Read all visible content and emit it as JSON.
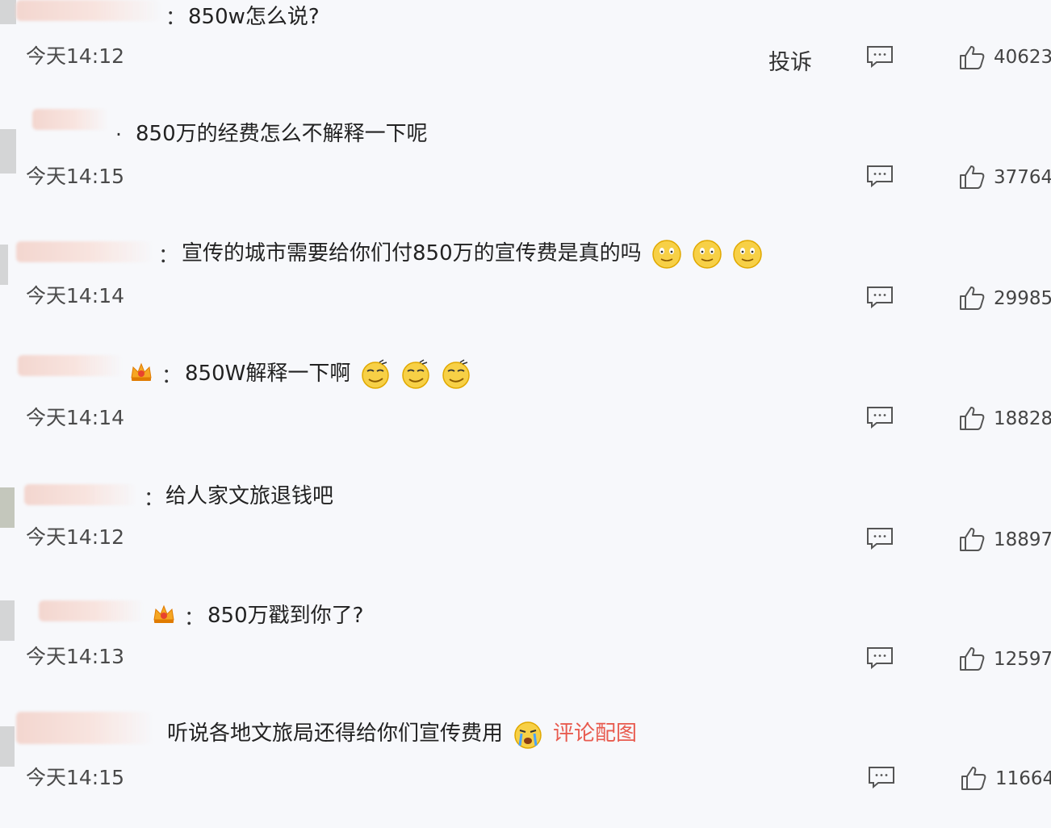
{
  "comments": [
    {
      "separator": "：",
      "text": "850w怎么说?",
      "time": "今天14:12",
      "likes": "40623",
      "report": "投诉",
      "badge": false,
      "emoji": [],
      "link": ""
    },
    {
      "separator": ".",
      "text": "850万的经费怎么不解释一下呢",
      "time": "今天14:15",
      "likes": "37764",
      "badge": false,
      "emoji": [],
      "link": ""
    },
    {
      "separator": "：",
      "text": "宣传的城市需要给你们付850万的宣传费是真的吗",
      "time": "今天14:14",
      "likes": "29985",
      "badge": false,
      "emoji": [
        "smile-emoji",
        "smile-emoji",
        "smile-emoji"
      ],
      "link": ""
    },
    {
      "separator": "：",
      "text": "850W解释一下啊",
      "time": "今天14:14",
      "likes": "18828",
      "badge": true,
      "emoji": [
        "smirk-emoji",
        "smirk-emoji",
        "smirk-emoji"
      ],
      "link": ""
    },
    {
      "separator": "：",
      "text": "给人家文旅退钱吧",
      "time": "今天14:12",
      "likes": "18897",
      "badge": false,
      "emoji": [],
      "link": ""
    },
    {
      "separator": "：",
      "text": "850万戳到你了?",
      "time": "今天14:13",
      "likes": "12597",
      "badge": true,
      "emoji": [],
      "link": ""
    },
    {
      "separator": "",
      "text": "听说各地文旅局还得给你们宣传费用",
      "time": "今天14:15",
      "likes": "11664",
      "badge": false,
      "emoji": [
        "crying-emoji"
      ],
      "link": "评论配图"
    }
  ],
  "colors": {
    "background": "#f7f8fb",
    "link": "#e85b4f",
    "icon": "#555555"
  }
}
